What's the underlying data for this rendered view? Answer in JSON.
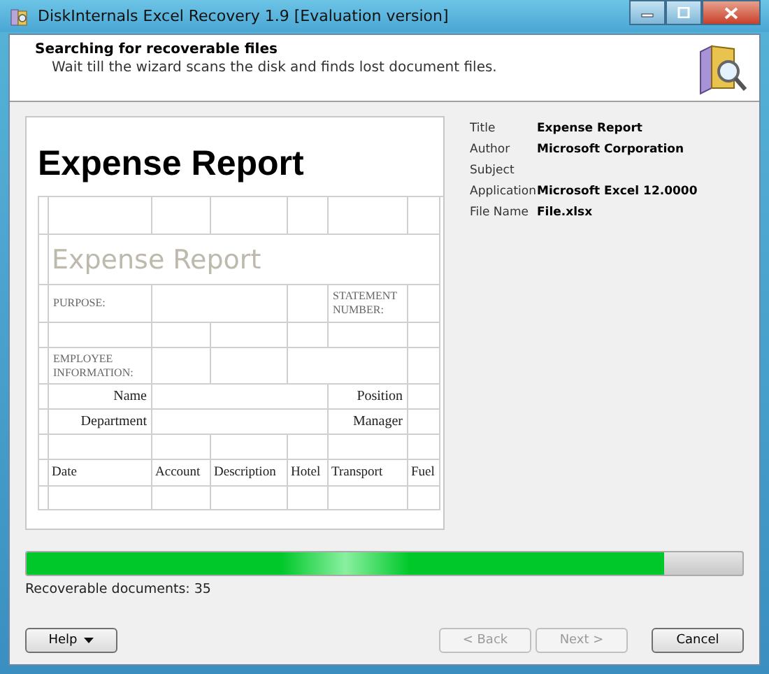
{
  "window": {
    "title": "DiskInternals Excel Recovery 1.9 [Evaluation version]"
  },
  "header": {
    "title": "Searching for recoverable files",
    "subtitle": "Wait till the wizard scans the disk and finds lost document files."
  },
  "preview": {
    "heading": "Expense Report",
    "rows": [
      {
        "kind": "plain",
        "cells": [
          "",
          "",
          "",
          "",
          "",
          "",
          ""
        ]
      },
      {
        "kind": "title",
        "cells": [
          "",
          "Expense Report",
          "",
          "",
          "",
          "",
          ""
        ]
      },
      {
        "kind": "caps",
        "cells": [
          "",
          "PURPOSE:",
          "",
          "",
          "",
          "STATEMENT NUMBER:",
          ""
        ]
      },
      {
        "kind": "plain",
        "cells": [
          "",
          "",
          "",
          "",
          "",
          "",
          ""
        ]
      },
      {
        "kind": "caps",
        "cells": [
          "",
          "EMPLOYEE INFORMATION:",
          "",
          "",
          "",
          "",
          ""
        ]
      },
      {
        "kind": "label",
        "cells": [
          "",
          "Name",
          "",
          "",
          "",
          "Position",
          ""
        ]
      },
      {
        "kind": "label",
        "cells": [
          "",
          "Department",
          "",
          "",
          "",
          "Manager",
          ""
        ]
      },
      {
        "kind": "plain",
        "cells": [
          "",
          "",
          "",
          "",
          "",
          "",
          ""
        ]
      },
      {
        "kind": "head",
        "cells": [
          "",
          "Date",
          "Account",
          "Description",
          "Hotel",
          "Transport",
          "Fuel"
        ]
      },
      {
        "kind": "plain",
        "cells": [
          "",
          "",
          "",
          "",
          "",
          "",
          ""
        ]
      }
    ]
  },
  "properties": [
    {
      "label": "Title",
      "value": "Expense Report"
    },
    {
      "label": "Author",
      "value": "Microsoft Corporation"
    },
    {
      "label": "Subject"
    },
    {
      "label": "Application",
      "value": "Microsoft Excel 12.0000"
    },
    {
      "label": "File Name",
      "value": "File.xlsx"
    }
  ],
  "progress": {
    "level": 0.89
  },
  "status": "Recoverable documents: 35",
  "buttons": [
    {
      "label": "Help",
      "kind": "menu",
      "disabled": false
    },
    {
      "label": "< Back",
      "kind": "plain",
      "disabled": true
    },
    {
      "label": "Next >",
      "kind": "plain",
      "disabled": true
    },
    {
      "label": "Cancel",
      "kind": "plain",
      "disabled": false
    }
  ]
}
